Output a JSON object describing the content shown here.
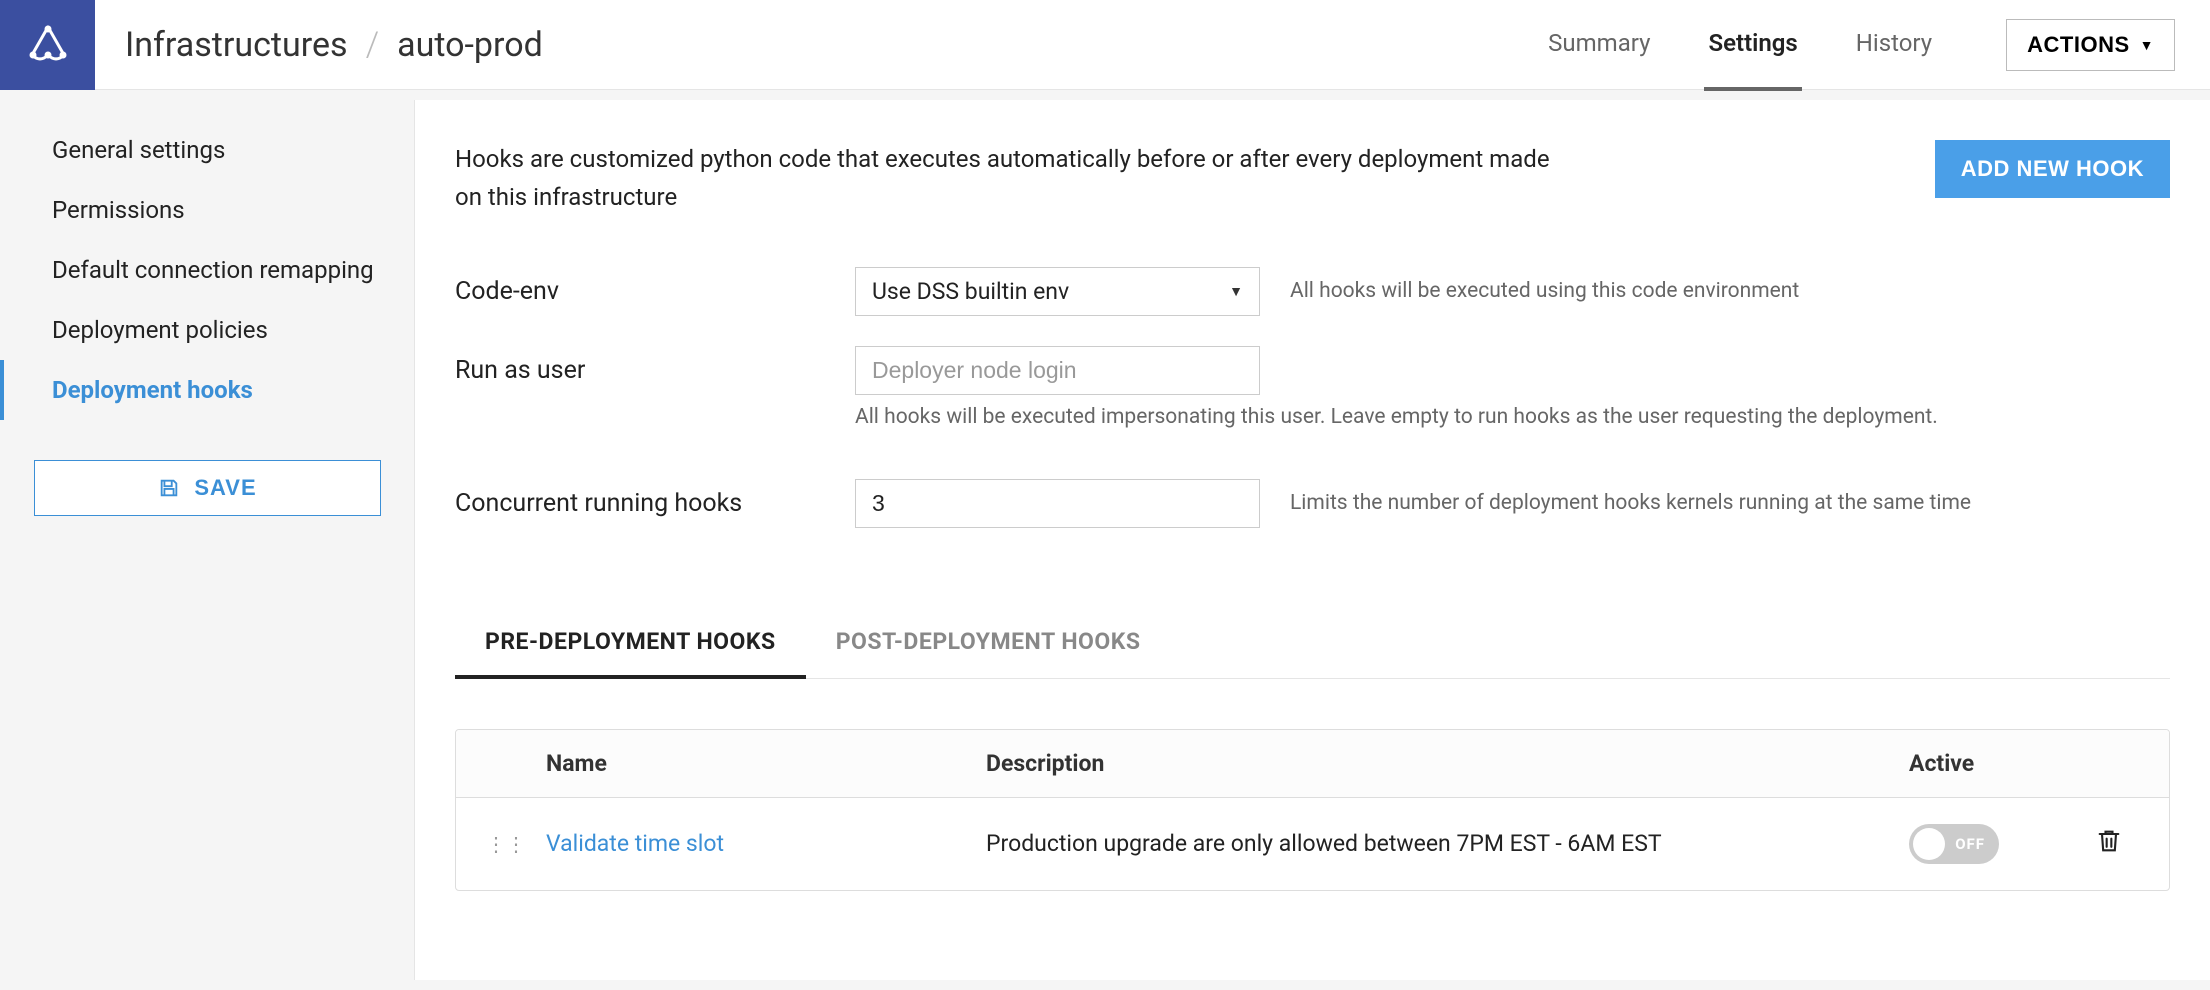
{
  "header": {
    "breadcrumb_root": "Infrastructures",
    "breadcrumb_current": "auto-prod",
    "tabs": [
      {
        "label": "Summary",
        "active": false
      },
      {
        "label": "Settings",
        "active": true
      },
      {
        "label": "History",
        "active": false
      }
    ],
    "actions_label": "ACTIONS"
  },
  "sidebar": {
    "items": [
      {
        "label": "General settings",
        "active": false
      },
      {
        "label": "Permissions",
        "active": false
      },
      {
        "label": "Default connection remapping",
        "active": false
      },
      {
        "label": "Deployment policies",
        "active": false
      },
      {
        "label": "Deployment hooks",
        "active": true
      }
    ],
    "save_label": "SAVE"
  },
  "main": {
    "intro": "Hooks are customized python code that executes automatically before or after every deployment made on this infrastructure",
    "add_hook_label": "ADD NEW HOOK",
    "codeenv": {
      "label": "Code-env",
      "value": "Use DSS builtin env",
      "help": "All hooks will be executed using this code environment"
    },
    "runas": {
      "label": "Run as user",
      "placeholder": "Deployer node login",
      "value": "",
      "help": "All hooks will be executed impersonating this user. Leave empty to run hooks as the user requesting the deployment."
    },
    "concurrent": {
      "label": "Concurrent running hooks",
      "value": "3",
      "help": "Limits the number of deployment hooks kernels running at the same time"
    },
    "hook_tabs": [
      {
        "label": "PRE-DEPLOYMENT HOOKS",
        "active": true
      },
      {
        "label": "POST-DEPLOYMENT HOOKS",
        "active": false
      }
    ],
    "hooks_columns": {
      "name": "Name",
      "description": "Description",
      "active": "Active"
    },
    "hooks": [
      {
        "name": "Validate time slot",
        "description": "Production upgrade are only allowed between 7PM EST - 6AM EST",
        "active_label": "OFF",
        "active": false
      }
    ]
  }
}
